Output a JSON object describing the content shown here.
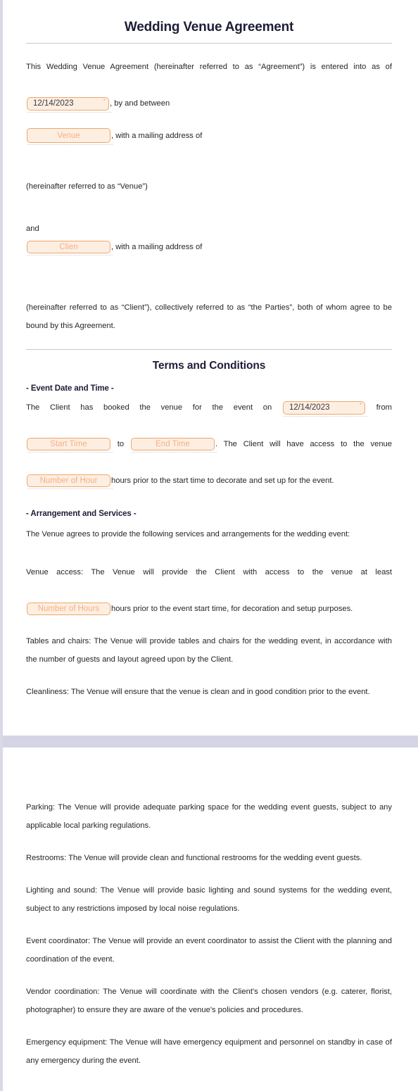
{
  "document": {
    "title": "Wedding Venue Agreement",
    "sections": {
      "terms_title": "Terms and Conditions",
      "event_date_heading": "- Event Date and Time -",
      "arrangement_heading": "- Arrangement and Services -"
    }
  },
  "intro": {
    "line1_before": "This Wedding Venue Agreement (hereinafter referred to as “Agreement”) is entered into as of",
    "line1_after": ", by and between",
    "venue_after": ", with a mailing address of",
    "venue_parenthetical": "(hereinafter referred to as “Venue”)",
    "and_label": "and",
    "client_after": ", with a mailing address of",
    "closing": "(hereinafter referred to as “Client”), collectively referred to as “the Parties”, both of whom agree to be bound by this Agreement."
  },
  "fields": {
    "agreement_date": {
      "value": "12/14/2023",
      "required_marker": "*"
    },
    "venue_name": {
      "placeholder": "Venue"
    },
    "client_name": {
      "placeholder": "Clien"
    },
    "event_date": {
      "value": "12/14/2023",
      "required_marker": "*"
    },
    "start_time": {
      "placeholder": "Start Time"
    },
    "end_time": {
      "placeholder": "End Time"
    },
    "setup_hours": {
      "placeholder": "Number of Hour"
    },
    "access_hours": {
      "placeholder": "Number of Hours"
    }
  },
  "event_date_time": {
    "part1": "The Client has booked the venue for the event on",
    "part2": "from",
    "part3": "to",
    "part4": ". The Client will have access to the venue",
    "part5": "hours prior to the start time to decorate and set up for the event."
  },
  "arrangement": {
    "intro": "The Venue agrees to provide the following services and arrangements for the wedding event:",
    "venue_access_before": "Venue access: The Venue will provide the Client with access to the venue at least",
    "venue_access_after": "hours prior to the event start time, for decoration and setup purposes.",
    "items": [
      "Tables and chairs: The Venue will provide tables and chairs for the wedding event, in accordance with the number of guests and layout agreed upon by the Client.",
      "Cleanliness: The Venue will ensure that the venue is clean and in good condition prior to the event."
    ]
  },
  "page_two": {
    "items": [
      "Parking: The Venue will provide adequate parking space for the wedding event guests, subject to any applicable local parking regulations.",
      "Restrooms: The Venue will provide clean and functional restrooms for the wedding event guests.",
      "Lighting and sound: The Venue will provide basic lighting and sound systems for the wedding event, subject to any restrictions imposed by local noise regulations.",
      "Event coordinator: The Venue will provide an event coordinator to assist the Client with the planning and coordination of the event.",
      "Vendor coordination: The Venue will coordinate with the Client's chosen vendors (e.g. caterer, florist, photographer) to ensure they are aware of the venue's policies and procedures.",
      "Emergency equipment: The Venue will have emergency equipment and personnel on standby in case of any emergency during the event."
    ]
  },
  "colors": {
    "field_fill": "#fdeee2",
    "field_border": "#f0a868",
    "placeholder_text": "#f5b183",
    "heading": "#1d1d38",
    "page_gap": "#d4d4e4"
  }
}
